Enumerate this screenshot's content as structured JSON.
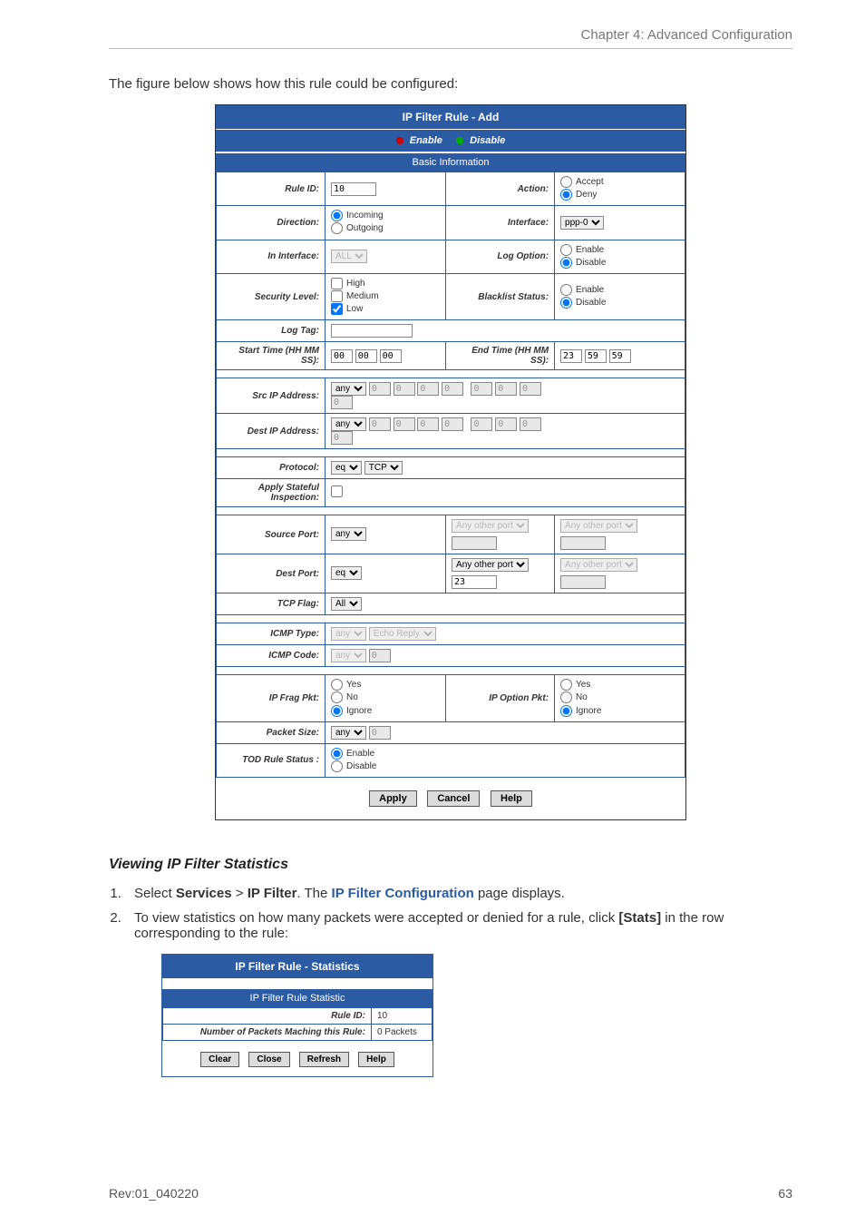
{
  "header": {
    "chapter": "Chapter 4: Advanced Configuration"
  },
  "intro": "The figure below shows how this rule could be configured:",
  "fig1": {
    "title": "IP Filter Rule - Add",
    "enable": "Enable",
    "disable": "Disable",
    "basic_info": "Basic Information",
    "rule_id_lbl": "Rule ID:",
    "rule_id_val": "10",
    "action_lbl": "Action:",
    "action_accept": "Accept",
    "action_deny": "Deny",
    "direction_lbl": "Direction:",
    "dir_in": "Incoming",
    "dir_out": "Outgoing",
    "interface_lbl": "Interface:",
    "interface_val": "ppp-0",
    "in_interface_lbl": "In Interface:",
    "in_interface_val": "ALL",
    "log_option_lbl": "Log Option:",
    "log_enable": "Enable",
    "log_disable": "Disable",
    "sec_level_lbl": "Security Level:",
    "sec_high": "High",
    "sec_med": "Medium",
    "sec_low": "Low",
    "blacklist_lbl": "Blacklist Status:",
    "bl_enable": "Enable",
    "bl_disable": "Disable",
    "log_tag_lbl": "Log Tag:",
    "start_time_lbl": "Start Time (HH MM SS):",
    "end_time_lbl": "End Time (HH MM SS):",
    "st_hh": "00",
    "st_mm": "00",
    "st_ss": "00",
    "et_hh": "23",
    "et_mm": "59",
    "et_ss": "59",
    "src_ip_lbl": "Src IP Address:",
    "dest_ip_lbl": "Dest IP Address:",
    "ip_mode": "any",
    "zero": "0",
    "protocol_lbl": "Protocol:",
    "proto_op": "eq",
    "proto_val": "TCP",
    "stateful_lbl": "Apply Stateful Inspection:",
    "src_port_lbl": "Source Port:",
    "dst_port_lbl": "Dest Port:",
    "port_any": "any",
    "port_eq": "eq",
    "any_other_port": "Any other port",
    "dst_port_val": "23",
    "tcp_flag_lbl": "TCP Flag:",
    "tcp_flag_val": "All",
    "icmp_type_lbl": "ICMP Type:",
    "icmp_type_val": "Echo Reply",
    "icmp_code_lbl": "ICMP Code:",
    "ip_frag_lbl": "IP Frag Pkt:",
    "ip_opt_lbl": "IP Option Pkt:",
    "yes": "Yes",
    "no": "No",
    "ignore": "Ignore",
    "pkt_size_lbl": "Packet Size:",
    "tod_lbl": "TOD Rule Status :",
    "btn_apply": "Apply",
    "btn_cancel": "Cancel",
    "btn_help": "Help"
  },
  "subhead": "Viewing IP Filter Statistics",
  "step1": {
    "pre": "Select ",
    "services": "Services",
    "gt": " > ",
    "ipfilter": "IP Filter",
    "mid": ". The ",
    "link": "IP Filter Configuration",
    "post": " page displays."
  },
  "step2": {
    "pre": "To view statistics on how many packets were accepted or denied for a rule, click ",
    "stats": "[Stats]",
    "post": " in the row corresponding to the rule:"
  },
  "fig2": {
    "title": "IP Filter Rule - Statistics",
    "subtitle": "IP Filter Rule Statistic",
    "rule_id_lbl": "Rule ID:",
    "rule_id_val": "10",
    "packets_lbl": "Number of Packets Maching this Rule:",
    "packets_val": "0 Packets",
    "btn_clear": "Clear",
    "btn_close": "Close",
    "btn_refresh": "Refresh",
    "btn_help": "Help"
  },
  "footer": {
    "rev": "Rev:01_040220",
    "page": "63"
  }
}
